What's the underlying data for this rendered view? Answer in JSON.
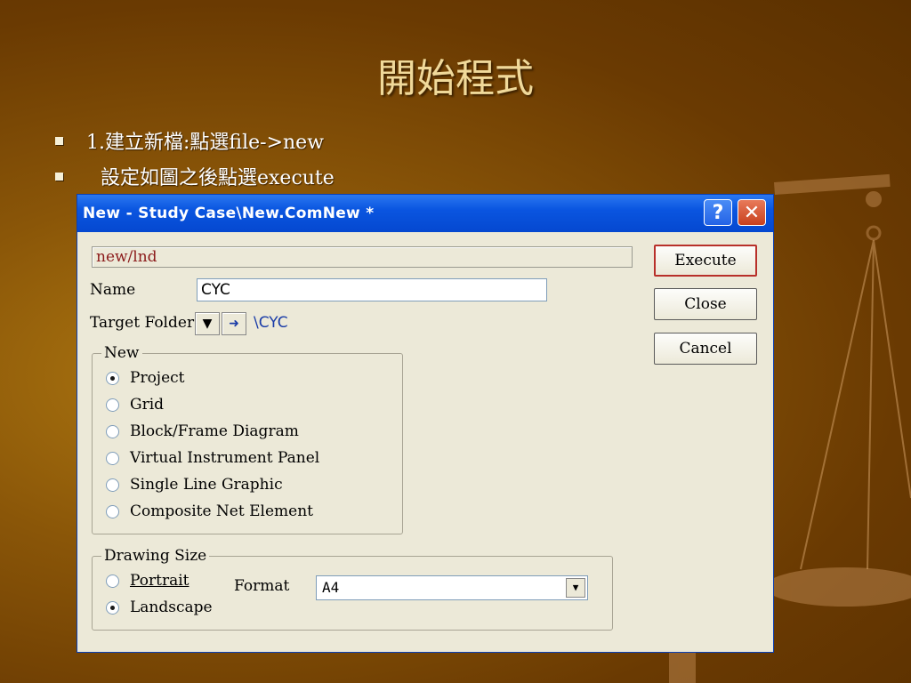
{
  "slide": {
    "title": "開始程式",
    "bullets": [
      "1.建立新檔:點選file->new",
      "設定如圖之後點選execute"
    ]
  },
  "dialog": {
    "title": "New - Study Case\\New.ComNew *",
    "help_label": "?",
    "close_label": "✕",
    "path_value": "new/lnd",
    "name_label": "Name",
    "name_value": "CYC",
    "target_folder_label": "Target Folder",
    "target_folder_value": "\\CYC",
    "new_group": {
      "legend": "New",
      "options": [
        {
          "label": "Project",
          "selected": true
        },
        {
          "label": "Grid",
          "selected": false
        },
        {
          "label": "Block/Frame Diagram",
          "selected": false
        },
        {
          "label": "Virtual Instrument Panel",
          "selected": false
        },
        {
          "label": "Single Line Graphic",
          "selected": false
        },
        {
          "label": "Composite Net Element",
          "selected": false
        }
      ]
    },
    "drawing_size": {
      "legend": "Drawing Size",
      "portrait_label": "Portrait",
      "landscape_label": "Landscape",
      "orientation": "Landscape",
      "format_label": "Format",
      "format_value": "A4"
    },
    "buttons": {
      "execute": "Execute",
      "close": "Close",
      "cancel": "Cancel"
    }
  },
  "colors": {
    "background": "#8a5608",
    "title_text": "#f0d99a",
    "titlebar": "#0a55e0",
    "path_text": "#8b1a1a",
    "folder_text": "#1a3ca8"
  }
}
